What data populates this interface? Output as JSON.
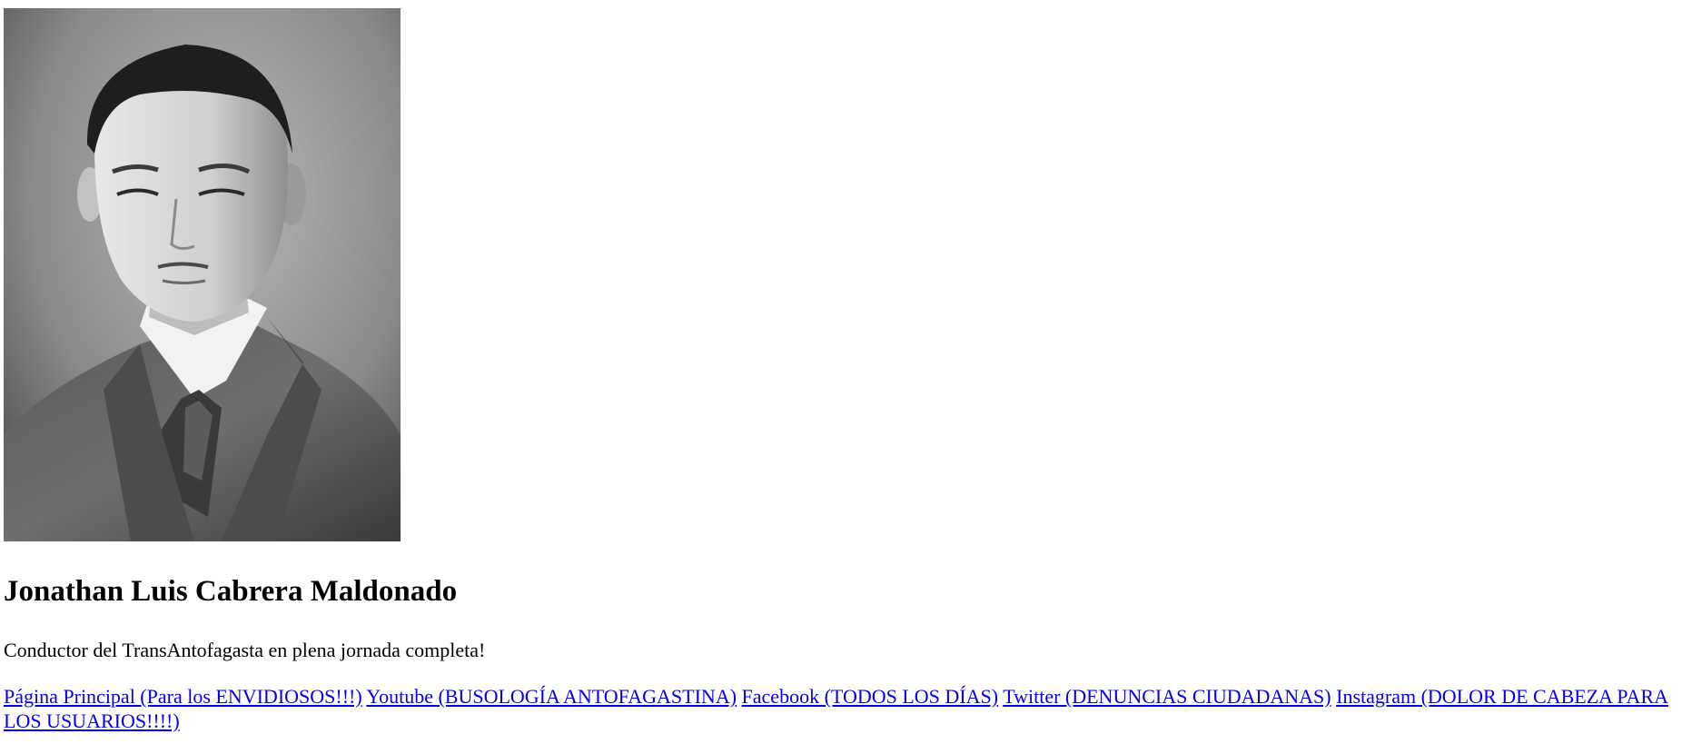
{
  "profile": {
    "name": "Jonathan Luis Cabrera Maldonado",
    "tagline": "Conductor del TransAntofagasta en plena jornada completa!"
  },
  "links": [
    {
      "label": "Página Principal (Para los ENVIDIOSOS!!!)"
    },
    {
      "label": "Youtube (BUSOLOGÍA ANTOFAGASTINA)"
    },
    {
      "label": "Facebook (TODOS LOS DÍAS)"
    },
    {
      "label": "Twitter (DENUNCIAS CIUDADANAS)"
    },
    {
      "label": "Instagram (DOLOR DE CABEZA PARA LOS USUARIOS!!!!)"
    }
  ],
  "colors": {
    "link": "#0000ee",
    "text": "#000000",
    "background": "#ffffff"
  }
}
